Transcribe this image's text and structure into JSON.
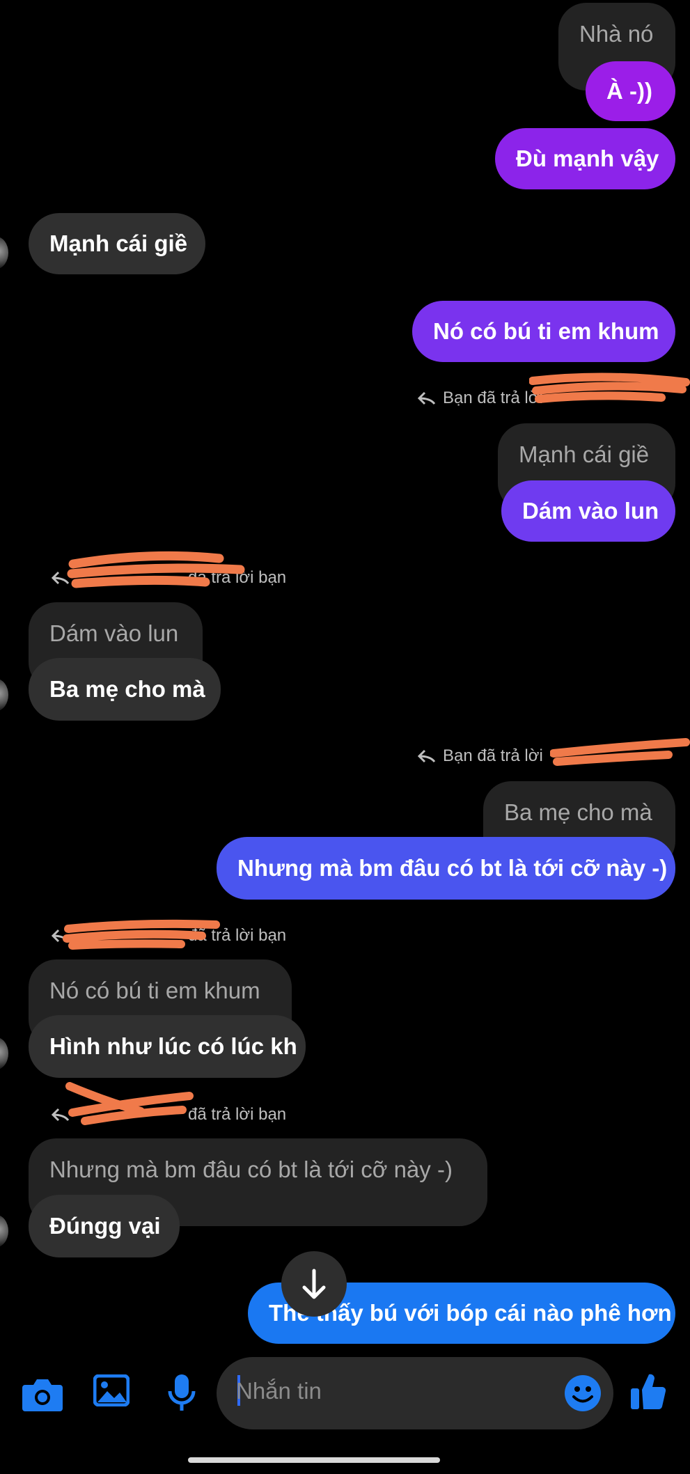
{
  "messages": {
    "m1_quote": "Nhà nó",
    "m1": "À -))",
    "m2": "Đù mạnh vậy",
    "m3": "Mạnh cái giề",
    "m4": "Nó có bú ti em khum",
    "r1_note": "Bạn đã trả lời",
    "m5_quote": "Mạnh cái giề",
    "m5": "Dám vào lun",
    "r2_note": "đã trả lời bạn",
    "m6_quote": "Dám vào lun",
    "m6": "Ba mẹ cho mà",
    "r3_note": "Bạn đã trả lời",
    "m7_quote": "Ba mẹ cho mà",
    "m7": "Nhưng mà bm đâu có bt là tới cỡ này -)",
    "r4_note": "đã trả lời bạn",
    "m8_quote": "Nó có bú ti em khum",
    "m8": "Hình như lúc có lúc kh",
    "r5_note": "đã trả lời bạn",
    "m9_quote": "Nhưng mà bm đâu có bt là tới cỡ này -)",
    "m9": "Đúngg vại",
    "m10": "The thấy bú với bóp cái nào phê hơn"
  },
  "composer": {
    "placeholder": "Nhắn tin",
    "icons": [
      "camera-icon",
      "image-icon",
      "microphone-icon",
      "emoji-icon",
      "like-icon"
    ]
  },
  "colors": {
    "background": "#000000",
    "incoming": "#303030",
    "quote": "#232323",
    "outgoing_top": "#9b1ee8",
    "outgoing_mid": "#6f3bf0",
    "outgoing_bottom": "#1a78f2",
    "accent": "#1e7cf2",
    "redaction": "#f07a4a"
  }
}
